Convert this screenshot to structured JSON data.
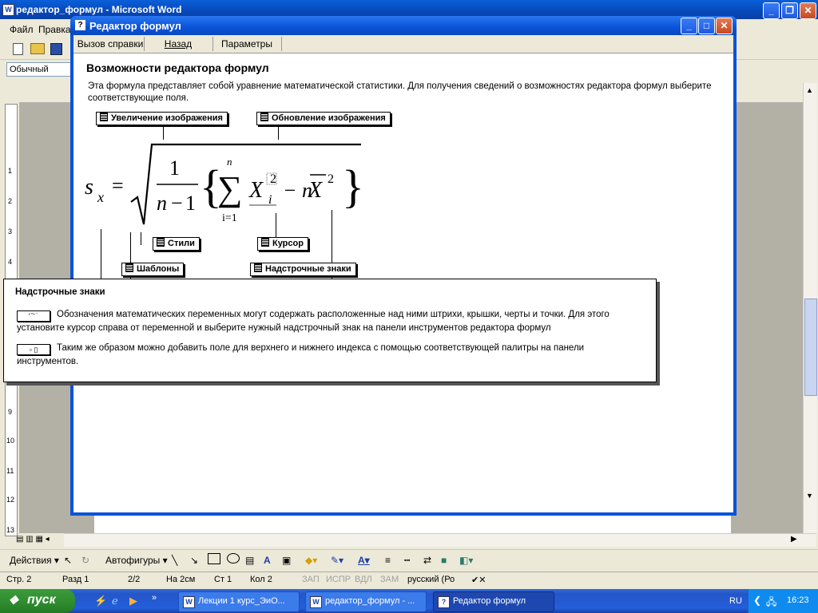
{
  "word": {
    "title": "редактор_формул - Microsoft Word",
    "menu": [
      "Файл",
      "Правка"
    ],
    "style": "Обычный",
    "ruler_marks": [
      "1",
      "2",
      "3",
      "4",
      "9",
      "10",
      "11",
      "12",
      "13"
    ]
  },
  "dialog": {
    "title": "Редактор формул",
    "toolbar": [
      "Вызов справки",
      "Назад",
      "Параметры"
    ],
    "heading": "Возможности редактора формул",
    "intro": "Эта формула представляет собой уравнение математической статистики. Для получения сведений о возможностях редактора формул выберите соответствующие поля.",
    "callouts": {
      "zoom": "Увеличение изображения",
      "refresh": "Обновление изображения",
      "styles": "Стили",
      "cursor": "Курсор",
      "templates": "Шаблоны",
      "embellishments": "Надстрочные знаки"
    },
    "formula": {
      "lhs": "s",
      "lhs_sub": "x",
      "eq": "=",
      "one": "1",
      "den_n": "n",
      "den_minus": "−",
      "den_one": "1",
      "sum_top": "n",
      "sum_bottom": "i=1",
      "X": "X",
      "X_sup": "2",
      "X_sub": "i",
      "minus_n": "− n",
      "Xbar": "X",
      "Xbar_sup": "2"
    }
  },
  "popup": {
    "heading": "Надстрочные знаки",
    "p1": "Обозначения математических переменных могут содержать расположенные над ними штрихи, крышки, черты и точки. Для этого установите курсор справа от переменной и выберите нужный надстрочный знак на панели инструментов редактора формул",
    "p2": "Таким же образом можно добавить поле для верхнего и нижнего индекса с помощью соответствующей палитры на панели инструментов."
  },
  "drawbar": {
    "actions": "Действия ▾",
    "autoshapes": "Автофигуры ▾"
  },
  "status": {
    "page": "Стр. 2",
    "section": "Разд 1",
    "pages": "2/2",
    "at": "На 2см",
    "line": "Ст 1",
    "col": "Кол 2",
    "rec": "ЗАП",
    "trk": "ИСПР",
    "ext": "ВДЛ",
    "ovr": "ЗАМ",
    "lang": "русский (Ро"
  },
  "taskbar": {
    "start": "пуск",
    "tasks": [
      "Лекции 1 курс_ЭиО...",
      "редактор_формул - ...",
      "Редактор формул"
    ],
    "lang": "RU",
    "clock": "16:23"
  }
}
